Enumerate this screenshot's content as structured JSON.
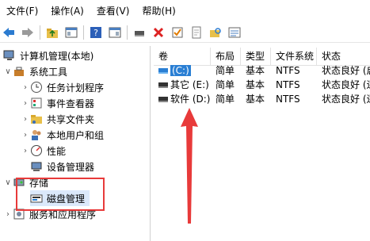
{
  "menu": [
    "文件(F)",
    "操作(A)",
    "查看(V)",
    "帮助(H)"
  ],
  "tree": {
    "root": "计算机管理(本地)",
    "system_tools": "系统工具",
    "task_scheduler": "任务计划程序",
    "event_viewer": "事件查看器",
    "shared_folders": "共享文件夹",
    "local_users": "本地用户和组",
    "performance": "性能",
    "device_manager": "设备管理器",
    "storage": "存储",
    "disk_management": "磁盘管理",
    "services": "服务和应用程序"
  },
  "table": {
    "headers": [
      "卷",
      "布局",
      "类型",
      "文件系统",
      "状态"
    ],
    "rows": [
      {
        "volume": "(C:)",
        "layout": "简单",
        "type": "基本",
        "fs": "NTFS",
        "status": "状态良好 (启"
      },
      {
        "volume": "其它 (E:)",
        "layout": "简单",
        "type": "基本",
        "fs": "NTFS",
        "status": "状态良好 (逻"
      },
      {
        "volume": "软件 (D:)",
        "layout": "简单",
        "type": "基本",
        "fs": "NTFS",
        "status": "状态良好 (逻"
      }
    ]
  },
  "colors": {
    "highlight_box": "#e83a3a",
    "arrow": "#e83a3a",
    "selection": "#dbe9fb"
  }
}
